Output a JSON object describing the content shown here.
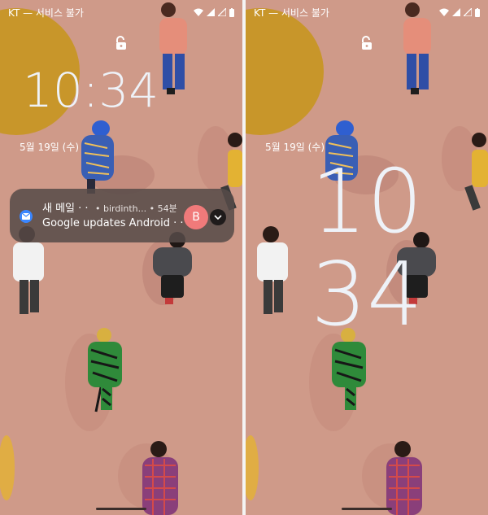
{
  "colors": {
    "wallpaper": "#cf9a89",
    "sun": "#c8962a",
    "clock": "#eef2f8",
    "notification_bg": "#564a48",
    "avatar": "#f07a7a",
    "mail_icon": "#3a86ff"
  },
  "left_screen": {
    "status": {
      "carrier": "KT — 서비스 불가",
      "icons": [
        "wifi-icon",
        "signal-icon",
        "signal-off-icon",
        "battery-icon"
      ]
    },
    "clock": "10:34",
    "date": "5월 19일 (수)",
    "notification": {
      "title": "새 메일 · ·",
      "sender": "• birdinth...",
      "time": "• 54분",
      "body": "Google updates Android · ·",
      "avatar_letter": "B",
      "app_icon": "mail-icon"
    }
  },
  "right_screen": {
    "status": {
      "carrier": "KT — 서비스 불가",
      "icons": [
        "wifi-icon",
        "signal-icon",
        "signal-off-icon",
        "battery-icon"
      ]
    },
    "date": "5월 19일 (수)",
    "clock_hours": "10",
    "clock_minutes": "34"
  }
}
